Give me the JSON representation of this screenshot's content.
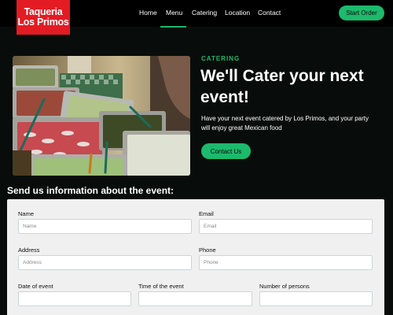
{
  "brand": {
    "line1": "Taqueria",
    "line2": "Los Primos",
    "color": "#e31b23"
  },
  "nav": {
    "items": [
      {
        "label": "Home",
        "active": false
      },
      {
        "label": "Menu",
        "active": true
      },
      {
        "label": "Catering",
        "active": false
      },
      {
        "label": "Location",
        "active": false
      },
      {
        "label": "Contact",
        "active": false
      }
    ],
    "order_button": "Start Order"
  },
  "hero": {
    "eyebrow": "CATERING",
    "title": "We'll Cater your next event!",
    "description": "Have your next event catered by Los Primos, and your party will enjoy great Mexican food",
    "cta": "Contact Us",
    "accent": "#1cba6c"
  },
  "form": {
    "title": "Send us information about the event:",
    "fields": {
      "name": {
        "label": "Name",
        "placeholder": "Name",
        "value": ""
      },
      "email": {
        "label": "Email",
        "placeholder": "Email",
        "value": ""
      },
      "address": {
        "label": "Address",
        "placeholder": "Address",
        "value": ""
      },
      "phone": {
        "label": "Phone",
        "placeholder": "Phone",
        "value": ""
      },
      "date": {
        "label": "Date of event",
        "placeholder": "",
        "value": ""
      },
      "time": {
        "label": "Time of the event",
        "placeholder": "",
        "value": ""
      },
      "persons": {
        "label": "Number of persons",
        "placeholder": "",
        "value": ""
      }
    }
  }
}
